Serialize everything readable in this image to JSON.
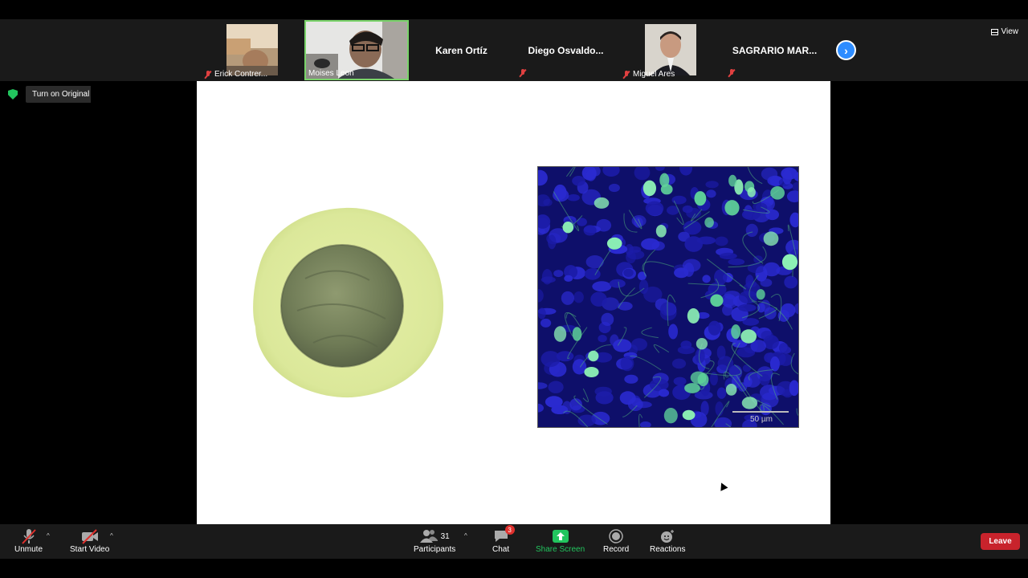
{
  "participants_strip": [
    {
      "name": "Erick Contrer..."
    },
    {
      "name": "Moises Leon"
    },
    {
      "name": "Karen Ortíz"
    },
    {
      "name": "Diego  Osvaldo..."
    },
    {
      "name": "Miguel Ares"
    },
    {
      "name": "SAGRARIO MAR..."
    }
  ],
  "view_label": "View",
  "original_sound_label": "Turn on Original Sound",
  "slide": {
    "scale_label": "50 µm"
  },
  "toolbar": {
    "unmute": "Unmute",
    "start_video": "Start Video",
    "participants": "Participants",
    "participants_count": "31",
    "chat": "Chat",
    "chat_badge": "3",
    "share_screen": "Share Screen",
    "record": "Record",
    "reactions": "Reactions",
    "leave": "Leave"
  },
  "colors": {
    "share_green": "#22c55e",
    "leave_red": "#c8232c",
    "accent_blue": "#2d8cff",
    "active_speaker": "#7ad36a"
  }
}
